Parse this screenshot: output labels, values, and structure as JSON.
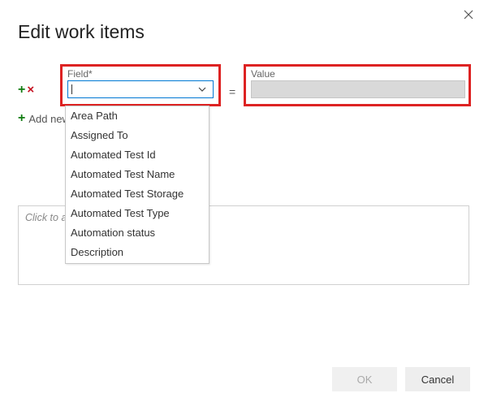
{
  "dialog": {
    "title": "Edit work items",
    "close_label": "Close"
  },
  "row": {
    "add_icon": "+",
    "remove_icon": "×",
    "field_label": "Field*",
    "field_value": "",
    "equals": "=",
    "value_label": "Value",
    "value_value": ""
  },
  "add_new": {
    "icon": "+",
    "label": "Add new clause"
  },
  "dropdown": {
    "options": [
      "Area Path",
      "Assigned To",
      "Automated Test Id",
      "Automated Test Name",
      "Automated Test Storage",
      "Automated Test Type",
      "Automation status",
      "Description"
    ]
  },
  "notes": {
    "placeholder": "Click to add notes"
  },
  "buttons": {
    "ok": "OK",
    "cancel": "Cancel"
  }
}
